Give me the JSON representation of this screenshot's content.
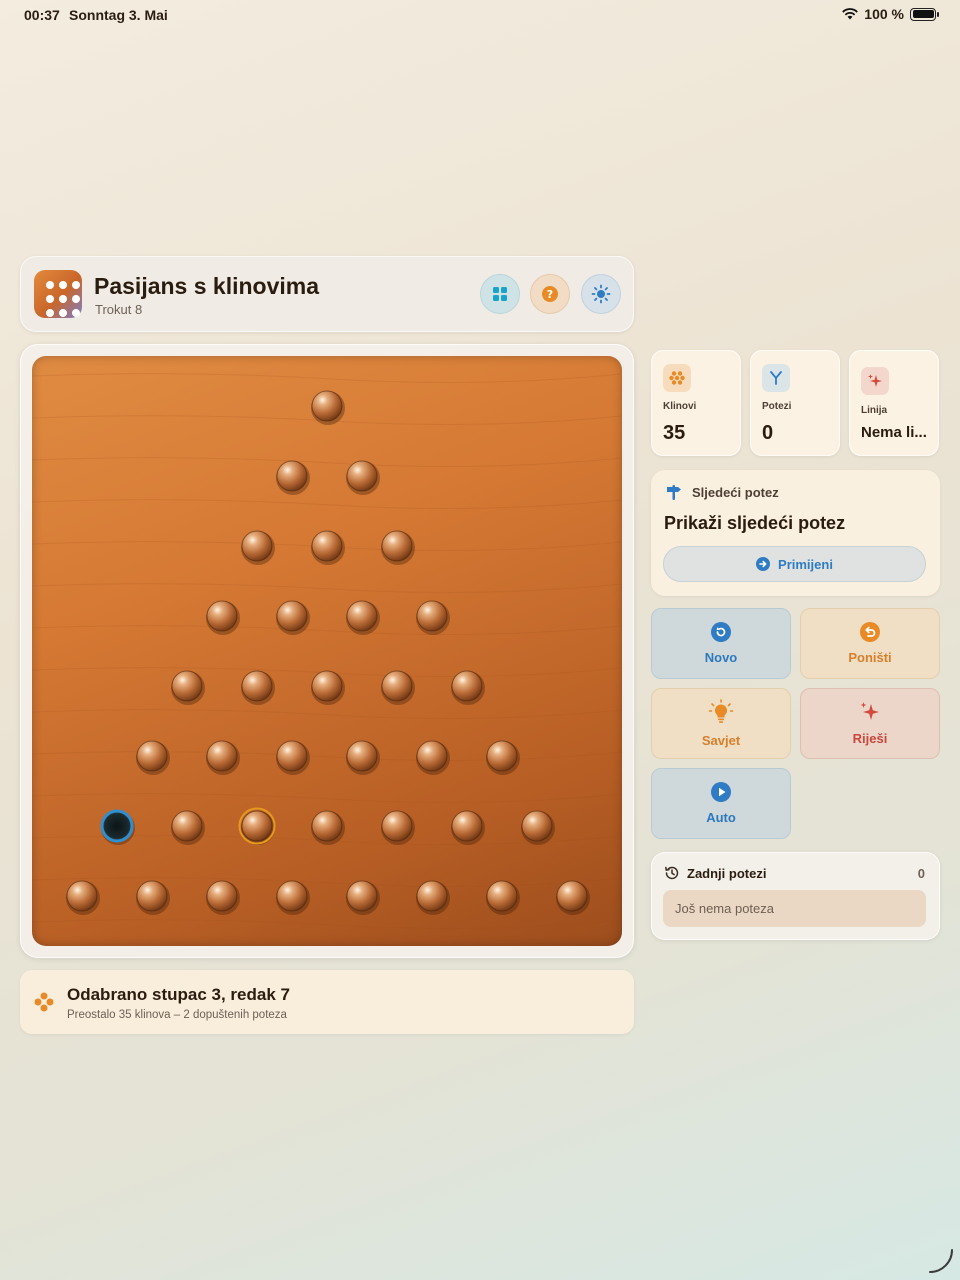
{
  "status_bar": {
    "time": "00:37",
    "date": "Sonntag 3. Mai",
    "battery_text": "100 %",
    "battery_level": 1.0
  },
  "header": {
    "title": "Pasijans s klinovima",
    "subtitle": "Trokut 8",
    "icons": [
      "grid-icon",
      "help-icon",
      "sun-icon"
    ]
  },
  "board": {
    "shape": "triangle",
    "rows": 8,
    "selected": {
      "column": 3,
      "row": 7
    },
    "empty": [
      {
        "column": 1,
        "row": 7
      }
    ],
    "colors": {
      "wood": "#d57934",
      "peg": "#c47a44",
      "empty_hole_ring": "#2f8fd1",
      "selected_ring": "#e59a1f"
    }
  },
  "status": {
    "title": "Odabrano stupac 3, redak 7",
    "subtitle": "Preostalo 35 klinova – 2 dopuštenih poteza"
  },
  "stats": [
    {
      "label": "Klinovi",
      "value": "35",
      "icon": "pegs-icon"
    },
    {
      "label": "Potezi",
      "value": "0",
      "icon": "moves-fork-icon"
    },
    {
      "label": "Linija",
      "value": "Nema li...",
      "icon": "sparkles-icon"
    }
  ],
  "next_move": {
    "label": "Sljedeći potez",
    "title": "Prikaži sljedeći potez",
    "apply": "Primijeni"
  },
  "actions": {
    "new": "Novo",
    "undo": "Poništi",
    "hint": "Savjet",
    "solve": "Riješi",
    "auto": "Auto"
  },
  "recent": {
    "title": "Zadnji potezi",
    "count": "0",
    "empty": "Još nema poteza"
  },
  "accent_colors": {
    "blue": "#2e79be",
    "orange": "#d77f2b",
    "red": "#c9473d"
  }
}
